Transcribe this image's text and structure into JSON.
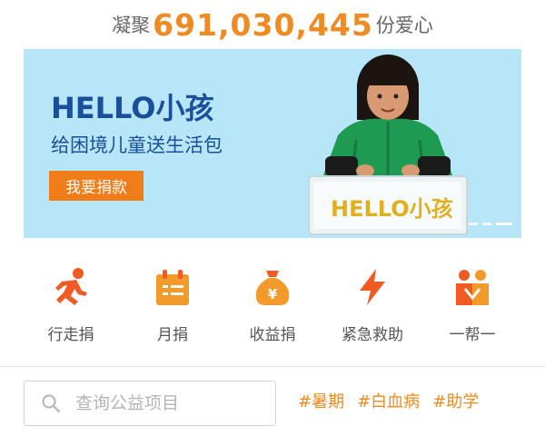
{
  "counter": {
    "prefix": "凝聚",
    "number": "691,030,445",
    "suffix": "份爱心"
  },
  "banner": {
    "title": "HELLO小孩",
    "subtitle": "给困境儿童送生活包",
    "donate_label": "我要捐款",
    "box_text": "HELLO小孩",
    "page_count": 3,
    "active_page": 3
  },
  "quick_actions": [
    {
      "label": "行走捐",
      "icon": "running-person-icon"
    },
    {
      "label": "月捐",
      "icon": "calendar-icon"
    },
    {
      "label": "收益捐",
      "icon": "money-bag-icon"
    },
    {
      "label": "紧急救助",
      "icon": "lightning-bolt-icon"
    },
    {
      "label": "一帮一",
      "icon": "two-people-icon"
    }
  ],
  "search": {
    "placeholder": "查询公益项目",
    "value": ""
  },
  "tags": [
    "#暑期",
    "#白血病",
    "#助学"
  ],
  "colors": {
    "accent": "#f08a22",
    "banner_bg": "#b7e6f9",
    "title_blue": "#1a4f9b"
  }
}
